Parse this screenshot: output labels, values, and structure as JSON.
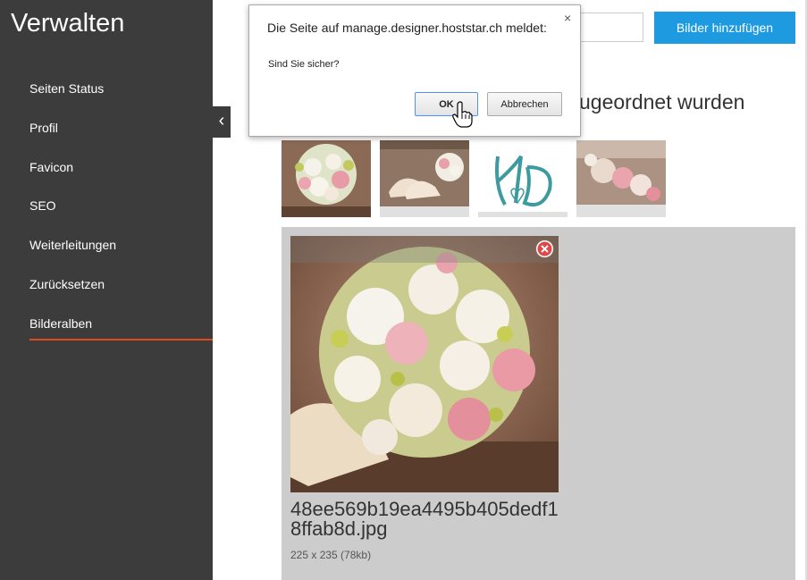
{
  "sidebar": {
    "title": "Verwalten",
    "items": [
      {
        "label": "Seiten Status"
      },
      {
        "label": "Profil"
      },
      {
        "label": "Favicon"
      },
      {
        "label": "SEO"
      },
      {
        "label": "Weiterleitungen"
      },
      {
        "label": "Zurücksetzen"
      },
      {
        "label": "Bilderalben"
      }
    ],
    "active_index": 6,
    "accent_color": "#e24a1c"
  },
  "toolbar": {
    "add_images_label": "Bilder hinzufügen",
    "button_color": "#1e9be0"
  },
  "section": {
    "heading_visible_fragment": "ugeordnet wurden"
  },
  "thumbnails": [
    {
      "icon": "rose-bouquet-image"
    },
    {
      "icon": "shoes-and-bouquet-image"
    },
    {
      "icon": "hd-monogram-logo-image"
    },
    {
      "icon": "roses-on-wood-image"
    }
  ],
  "detail": {
    "file_name": "48ee569b19ea4495b405dedf18ffab8d.jpg",
    "dimensions": "225 x 235 (78kb)"
  },
  "dialog": {
    "title": "Die Seite auf manage.designer.hoststar.ch meldet:",
    "message": "Sind Sie sicher?",
    "ok_label": "OK",
    "cancel_label": "Abbrechen",
    "close_glyph": "×"
  }
}
